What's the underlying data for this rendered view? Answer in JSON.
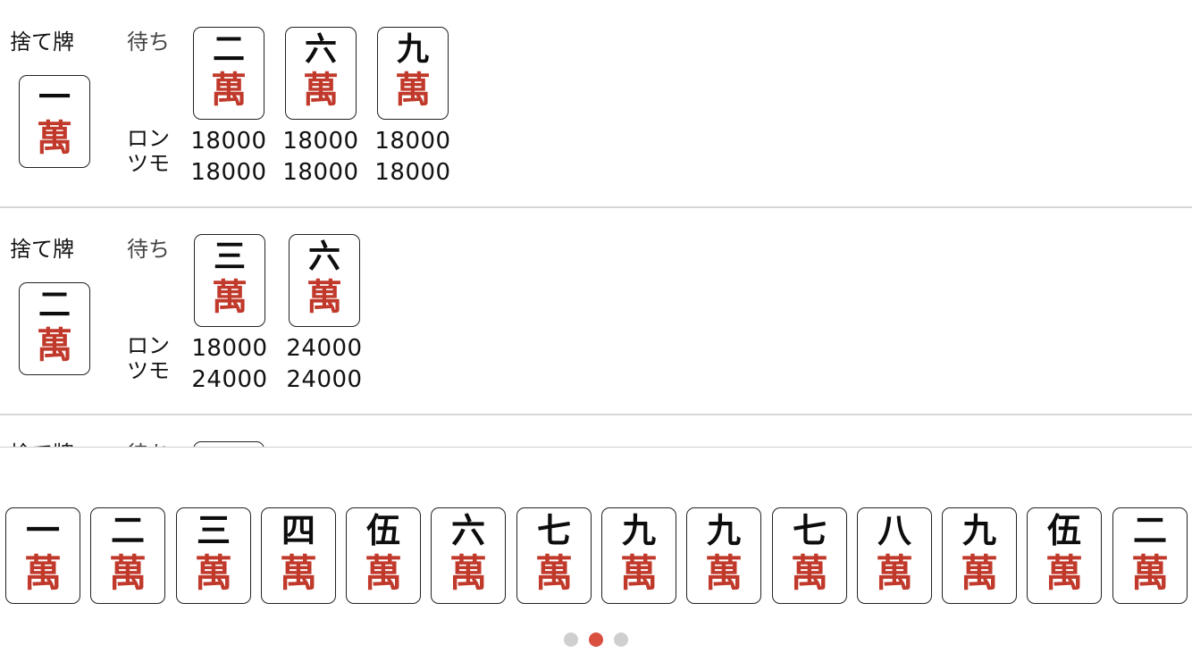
{
  "labels": {
    "discard": "捨て牌",
    "wait": "待ち",
    "ron": "ロン",
    "tsumo": "ツモ"
  },
  "suit_char": "萬",
  "rows": [
    {
      "discard": "一",
      "waits": [
        {
          "tile": "二",
          "ron": "18000",
          "tsumo": "18000"
        },
        {
          "tile": "六",
          "ron": "18000",
          "tsumo": "18000"
        },
        {
          "tile": "九",
          "ron": "18000",
          "tsumo": "18000"
        }
      ]
    },
    {
      "discard": "二",
      "waits": [
        {
          "tile": "三",
          "ron": "18000",
          "tsumo": "24000"
        },
        {
          "tile": "六",
          "ron": "24000",
          "tsumo": "24000"
        }
      ]
    }
  ],
  "partial_row": {
    "discard_label": "捨て牌",
    "wait_label": "待ち"
  },
  "hand": [
    "一",
    "二",
    "三",
    "四",
    "伍",
    "六",
    "七",
    "九",
    "九",
    "七",
    "八",
    "九",
    "伍",
    "二"
  ],
  "pager": {
    "count": 3,
    "active": 2
  },
  "colors": {
    "accent": "#d9503f",
    "suit_red": "#c0392b",
    "divider": "#d6d6d6"
  }
}
